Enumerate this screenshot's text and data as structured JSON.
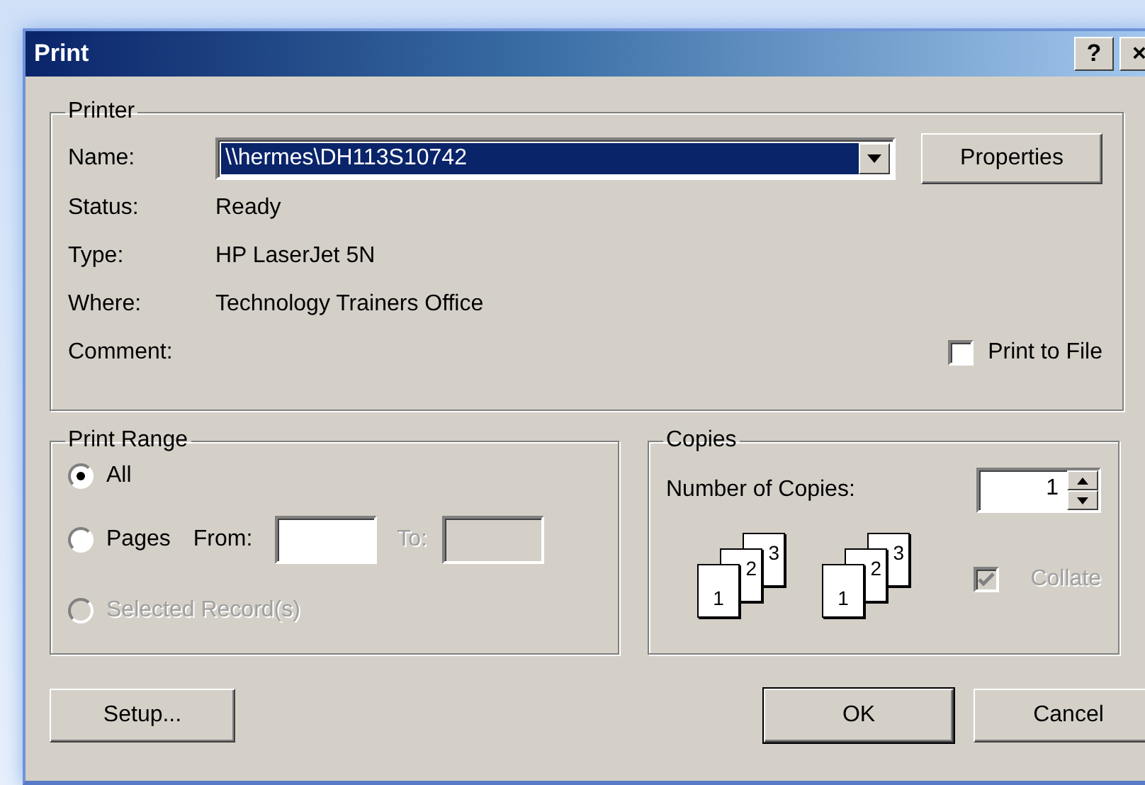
{
  "window": {
    "title": "Print",
    "help_button": "?",
    "close_button": "×"
  },
  "printer": {
    "group_label": "Printer",
    "name_label": "Name:",
    "name_value": "\\\\hermes\\DH113S10742",
    "properties_button": "Properties",
    "info": [
      {
        "label": "Status:",
        "value": "Ready"
      },
      {
        "label": "Type:",
        "value": "HP LaserJet 5N"
      },
      {
        "label": "Where:",
        "value": "Technology Trainers Office"
      }
    ],
    "comment_label": "Comment:",
    "print_to_file": {
      "label": "Print to File",
      "checked": false
    }
  },
  "print_range": {
    "group_label": "Print Range",
    "options": [
      {
        "kind": "all",
        "label": "All",
        "selected": true,
        "disabled": false
      },
      {
        "kind": "pages",
        "label": "Pages",
        "selected": false,
        "disabled": false
      },
      {
        "kind": "selection",
        "label": "Selected Record(s)",
        "selected": false,
        "disabled": true
      }
    ],
    "from_field": {
      "label": "From:",
      "disabled": false
    },
    "to_field": {
      "label": "To:",
      "disabled": true
    }
  },
  "copies": {
    "group_label": "Copies",
    "number_label": "Number of Copies:",
    "number_value": "1",
    "stacks": [
      [
        "1",
        "2",
        "3"
      ],
      [
        "1",
        "2",
        "3"
      ]
    ],
    "collate": {
      "label": "Collate",
      "checked": true,
      "disabled": true
    }
  },
  "buttons": [
    {
      "label": "Setup...",
      "default": false
    },
    {
      "label": "OK",
      "default": true
    },
    {
      "label": "Cancel",
      "default": false
    }
  ]
}
